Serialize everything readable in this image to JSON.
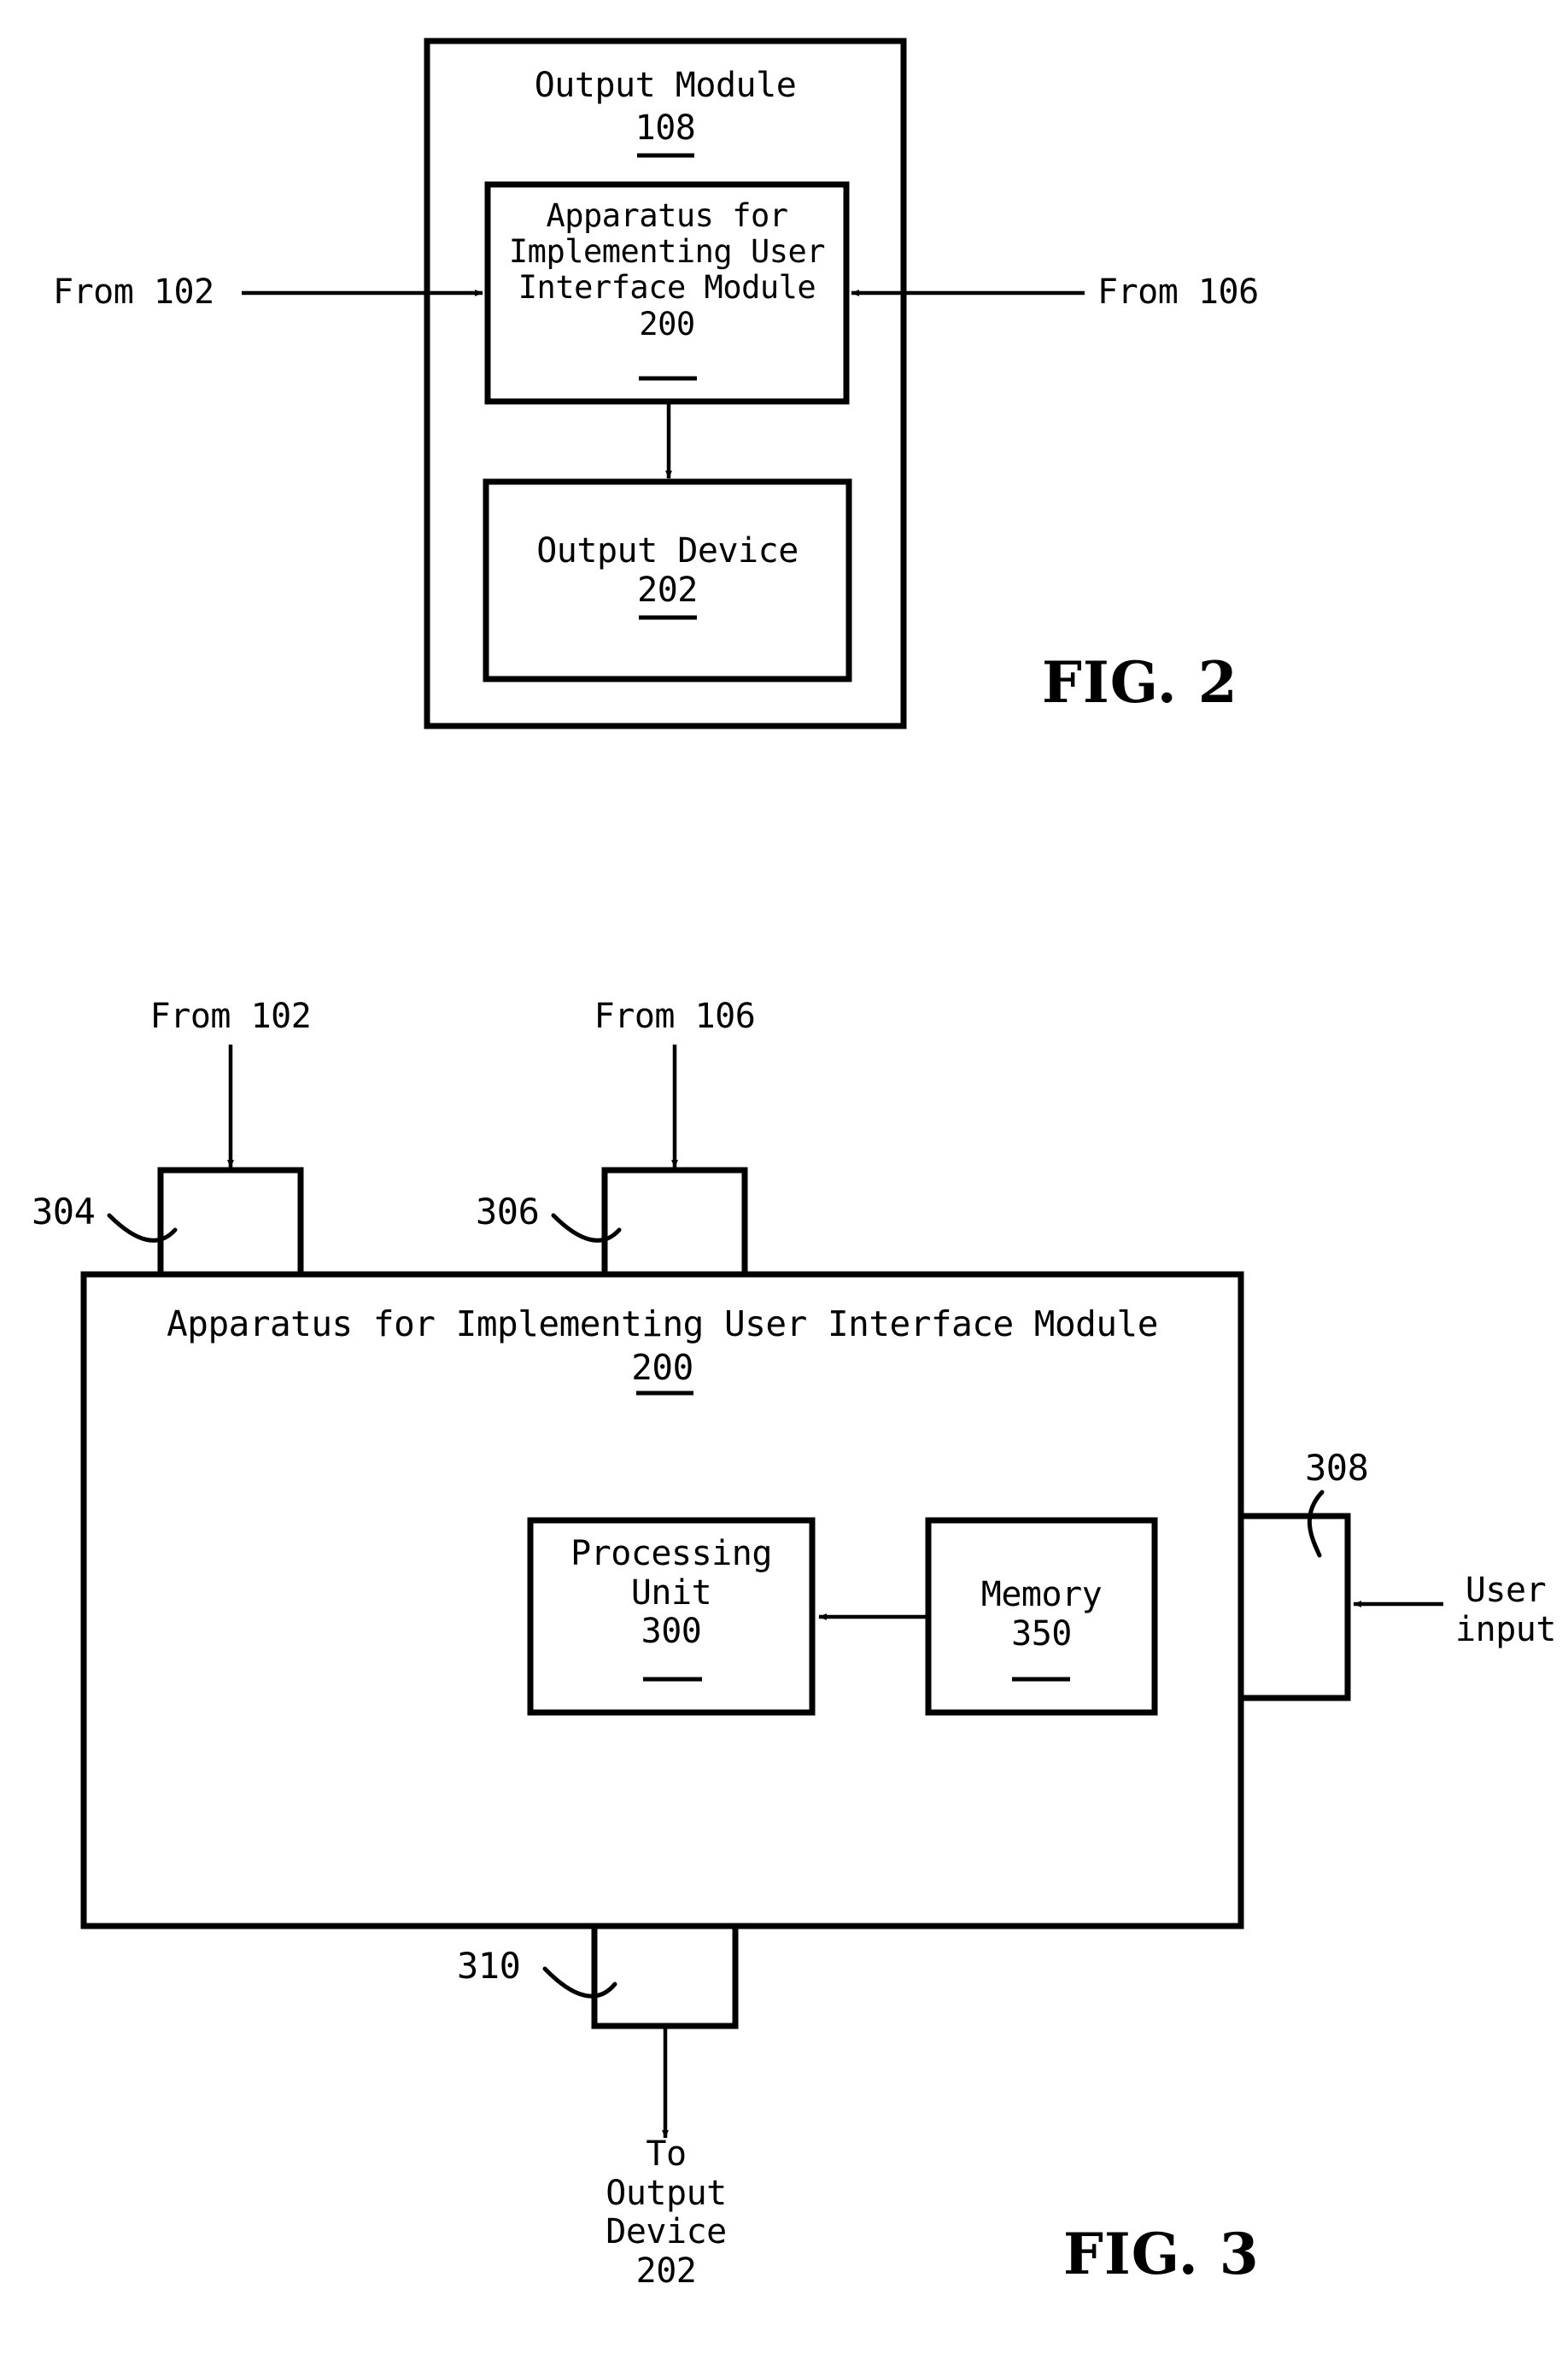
{
  "document": {
    "type": "patent-drawing-sheet",
    "background_color": "#ffffff",
    "ink_color": "#000000"
  },
  "figures": [
    {
      "id": "fig2",
      "caption": "FIG. 2",
      "outer_box": {
        "title": "Output Module",
        "ref": "108"
      },
      "inner_boxes": [
        {
          "id": "fig2-box-200",
          "title_line1": "Apparatus for",
          "title_line2": "Implementing User",
          "title_line3": "Interface Module",
          "ref": "200"
        },
        {
          "id": "fig2-box-202",
          "title_line1": "Output Device",
          "ref": "202"
        }
      ],
      "inputs": [
        {
          "id": "fig2-from-102",
          "label": "From 102",
          "side": "left"
        },
        {
          "id": "fig2-from-106",
          "label": "From 106",
          "side": "right"
        }
      ]
    },
    {
      "id": "fig3",
      "caption": "FIG. 3",
      "main_box": {
        "title": "Apparatus for Implementing User Interface Module",
        "ref": "200"
      },
      "ports": [
        {
          "id": "port-304",
          "ref": "304",
          "source_label": "From 102",
          "position": "top-left"
        },
        {
          "id": "port-306",
          "ref": "306",
          "source_label": "From 106",
          "position": "top-right"
        },
        {
          "id": "port-308",
          "ref": "308",
          "source_label": "User\ninput",
          "position": "right"
        },
        {
          "id": "port-310",
          "ref": "310",
          "target_label": "To\nOutput\nDevice\n202",
          "position": "bottom"
        }
      ],
      "inner_boxes": [
        {
          "id": "fig3-box-300",
          "title_line1": "Processing",
          "title_line2": "Unit",
          "ref": "300"
        },
        {
          "id": "fig3-box-350",
          "title_line1": "Memory",
          "ref": "350"
        }
      ],
      "internal_arrow": {
        "id": "memory-to-processing",
        "from": "350",
        "to": "300",
        "direction": "left"
      }
    }
  ],
  "fig2": {
    "caption": "FIG. 2",
    "output_module_title": "Output Module",
    "output_module_ref": "108",
    "apparatus_line1": "Apparatus for",
    "apparatus_line2": "Implementing User",
    "apparatus_line3": "Interface Module",
    "apparatus_ref": "200",
    "output_device_title": "Output Device",
    "output_device_ref": "202",
    "from_102": "From 102",
    "from_106": "From 106"
  },
  "fig3": {
    "caption": "FIG. 3",
    "from_102": "From 102",
    "from_106": "From 106",
    "ref_304": "304",
    "ref_306": "306",
    "ref_308": "308",
    "ref_310": "310",
    "apparatus_title": "Apparatus for Implementing User Interface Module",
    "apparatus_ref": "200",
    "processing_line1": "Processing",
    "processing_line2": "Unit",
    "processing_ref": "300",
    "memory_title": "Memory",
    "memory_ref": "350",
    "user_input_line1": "User",
    "user_input_line2": "input",
    "to_output_line1": "To",
    "to_output_line2": "Output",
    "to_output_line3": "Device",
    "to_output_line4": "202"
  }
}
